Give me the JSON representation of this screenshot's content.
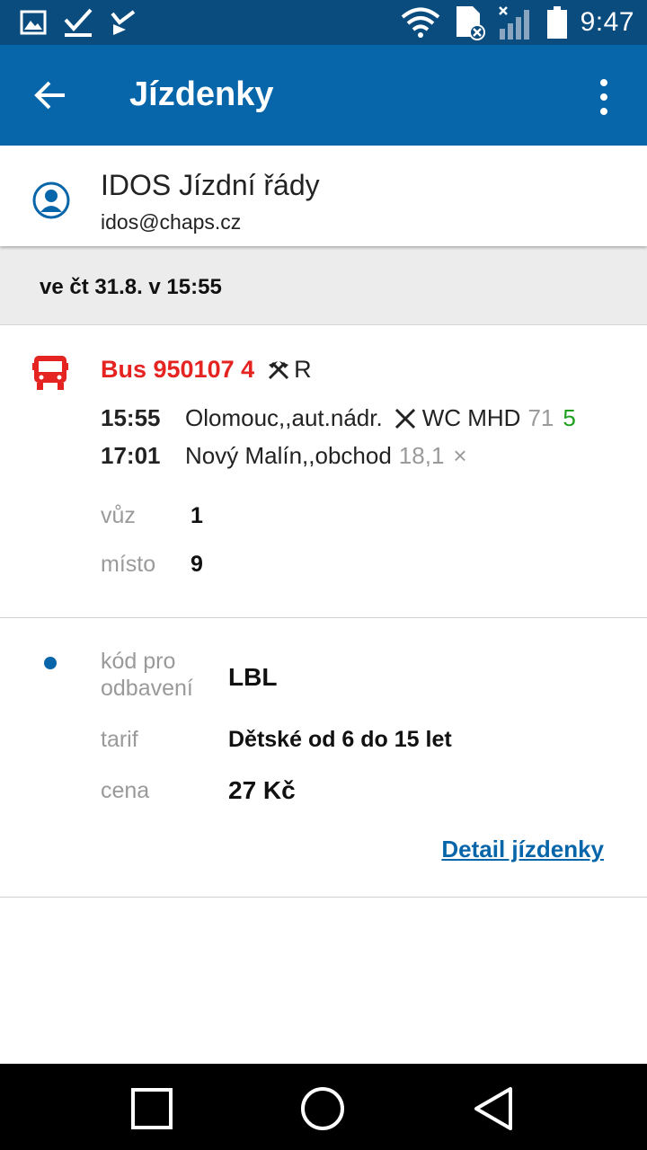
{
  "status_bar": {
    "time": "9:47",
    "icons_left": [
      "image-icon",
      "checkmark-icon",
      "check-play-icon"
    ],
    "icons_right": [
      "wifi-icon",
      "sim-icon",
      "signal-icon",
      "battery-icon"
    ]
  },
  "app_bar": {
    "title": "Jízdenky",
    "color": "#0765a9"
  },
  "account": {
    "name": "IDOS Jízdní řády",
    "email": "idos@chaps.cz"
  },
  "date_header": "ve čt 31.8. v 15:55",
  "trip": {
    "train": "Bus 950107 4",
    "flags": "R",
    "accent": "#e52421",
    "departure": {
      "time": "15:55",
      "station": "Olomouc,,aut.nádr.",
      "services": "WC MHD",
      "km": "71",
      "platform": "5"
    },
    "arrival": {
      "time": "17:01",
      "station": "Nový Malín,,obchod",
      "km": "18,1",
      "mark": "×"
    },
    "car_label": "vůz",
    "car_value": "1",
    "seat_label": "místo",
    "seat_value": "9"
  },
  "ticket": {
    "code_label_1": "kód pro",
    "code_label_2": "odbavení",
    "code_value": "LBL",
    "tariff_label": "tarif",
    "tariff_value": "Dětské od 6 do 15 let",
    "price_label": "cena",
    "price_value": "27 Kč",
    "detail_link": "Detail jízdenky"
  }
}
